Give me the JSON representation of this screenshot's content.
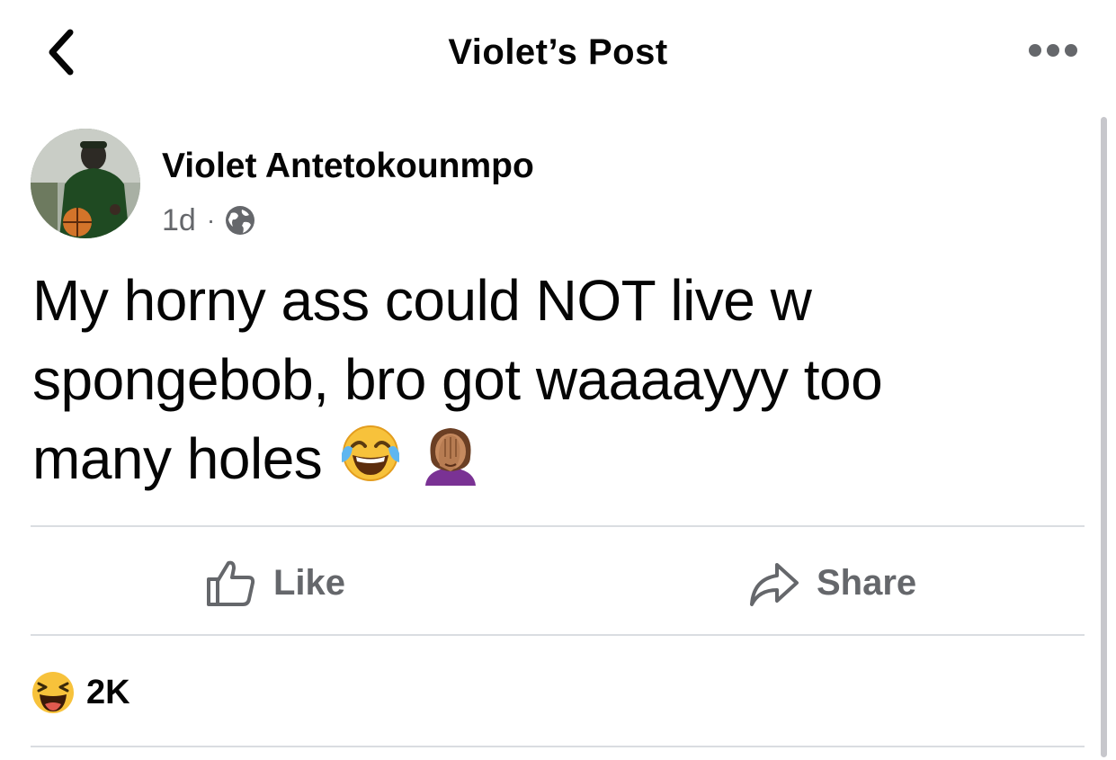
{
  "header": {
    "title": "Violet’s Post",
    "back_icon": "chevron-left-icon",
    "more_icon": "more-dots-icon"
  },
  "post": {
    "author": "Violet Antetokounmpo",
    "time": "1d",
    "separator": "·",
    "privacy_icon": "globe-icon",
    "text_lines": [
      "My horny ass could NOT live w",
      "spongebob, bro got waaaayyy too",
      "many holes"
    ],
    "emojis": [
      "tears-of-joy-emoji",
      "facepalm-emoji"
    ]
  },
  "actions": {
    "like_label": "Like",
    "share_label": "Share"
  },
  "reactions": {
    "icon": "laughing-reaction-icon",
    "count": "2K"
  },
  "colors": {
    "text": "#050505",
    "secondary": "#65676b",
    "divider": "#dadde1"
  }
}
